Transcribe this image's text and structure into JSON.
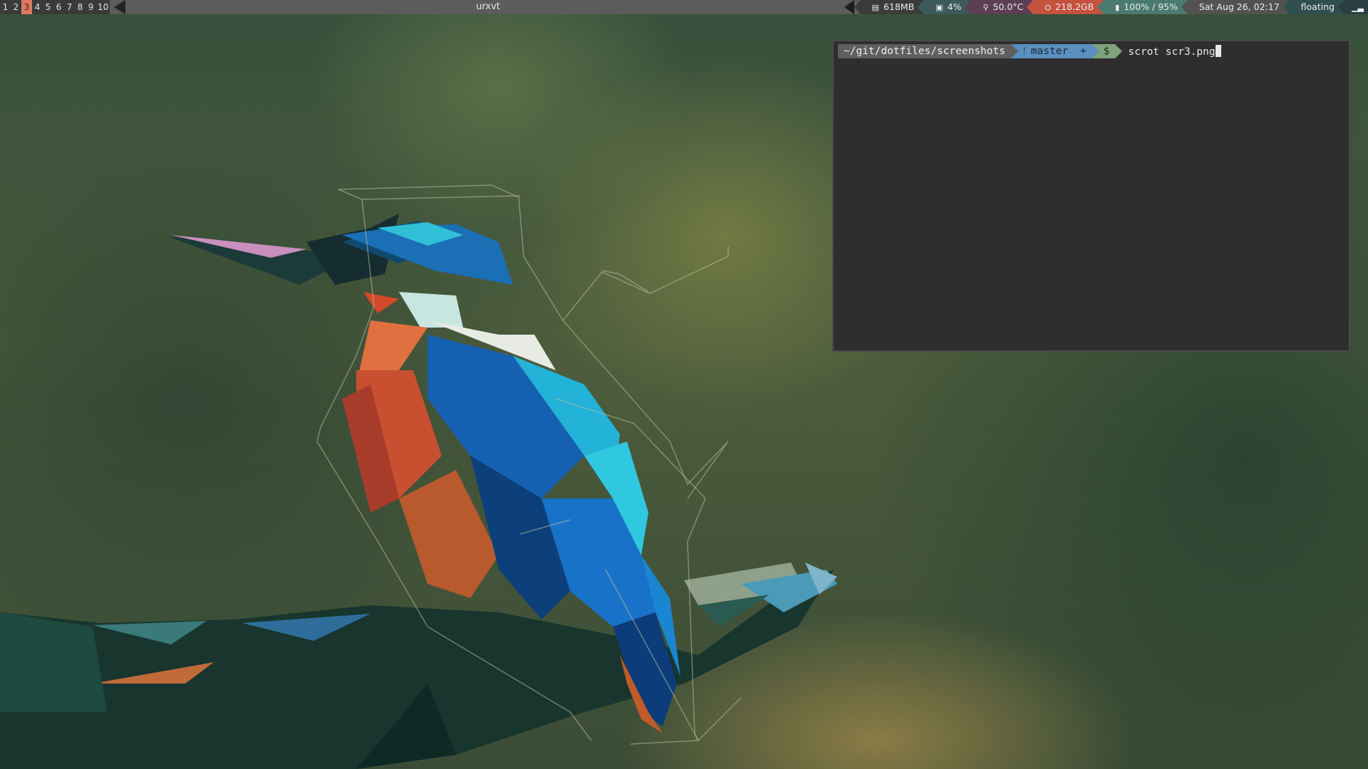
{
  "topbar": {
    "workspaces": [
      "1",
      "2",
      "3",
      "4",
      "5",
      "6",
      "7",
      "8",
      "9",
      "10"
    ],
    "active_workspace": "3",
    "window_title": "urxvt",
    "status": {
      "memory": "618MB",
      "cpu": "4%",
      "temperature": "50.0°C",
      "disk": "218.2GB",
      "battery": "100% / 95%",
      "datetime": "Sat Aug 26, 02:17",
      "layout_mode": "floating"
    },
    "icons": {
      "memory": "memory-icon",
      "cpu": "cpu-icon",
      "temperature": "thermometer-icon",
      "disk": "disk-icon",
      "battery": "battery-icon",
      "signal": "signal-icon"
    },
    "colors": {
      "active_workspace": "#e07a5f",
      "disk_segment": "#c5513f"
    }
  },
  "terminal": {
    "cwd": "~/git/dotfiles/screenshots",
    "branch": "master",
    "branch_status": "+",
    "prompt_symbol": "$",
    "command": "scrot scr3.png",
    "colors": {
      "path_bg": "#5f5f5f",
      "git_bg": "#5a8fbf",
      "symbol_bg": "#7fa37a"
    }
  },
  "wallpaper": {
    "subject": "kingfisher-polygon-art"
  }
}
